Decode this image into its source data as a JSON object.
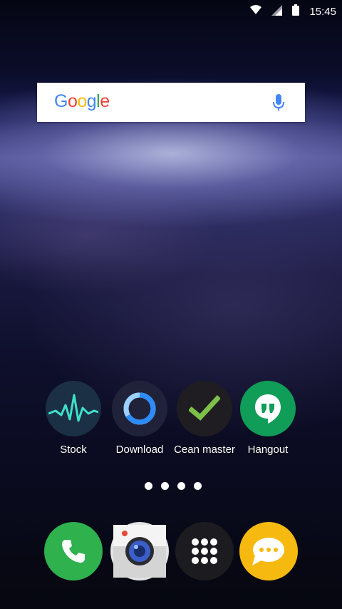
{
  "status_bar": {
    "time": "15:45",
    "icons": [
      "wifi-icon",
      "signal-icon",
      "battery-icon"
    ]
  },
  "search_widget": {
    "logo_text": [
      "G",
      "o",
      "o",
      "g",
      "l",
      "e"
    ],
    "mic_icon": "mic-icon"
  },
  "apps": [
    {
      "label": "Stock",
      "icon": "stock-chart-icon",
      "bg": "#1b2f45",
      "accent": "#3fe0c9"
    },
    {
      "label": "Download",
      "icon": "download-ring-icon",
      "bg": "#20223a",
      "accent": "#2a8cff"
    },
    {
      "label": "Cean master",
      "icon": "checkmark-icon",
      "bg": "#1f1d22",
      "accent": "#7cc04a"
    },
    {
      "label": "Hangout",
      "icon": "hangouts-icon",
      "bg": "#0f9d58",
      "accent": "#ffffff"
    }
  ],
  "page_indicator": {
    "count": 4
  },
  "dock": [
    {
      "name": "phone",
      "icon": "phone-icon",
      "bg": "#2fb14e"
    },
    {
      "name": "camera",
      "icon": "camera-icon",
      "bg": "#e3e3e3"
    },
    {
      "name": "app-drawer",
      "icon": "app-drawer-icon",
      "bg": "#1c1b1f"
    },
    {
      "name": "messages",
      "icon": "message-bubble-icon",
      "bg": "#f6b90f"
    }
  ]
}
